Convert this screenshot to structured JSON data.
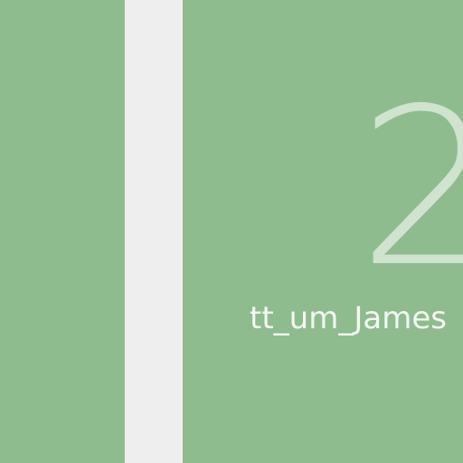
{
  "screen": {
    "background_color": "#8fbc8f",
    "strip_color": "#efeeef",
    "number_color": "#cfe3cf",
    "text_color": "#f3f7f3"
  },
  "content": {
    "number": "2",
    "username": "tt_um_James"
  }
}
